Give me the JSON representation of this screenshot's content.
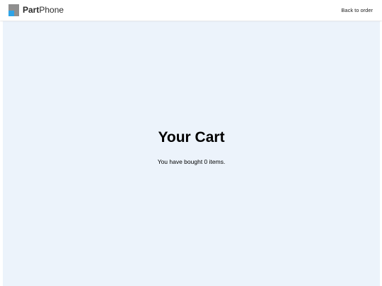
{
  "header": {
    "logo": {
      "text_strong": "Part",
      "text_regular": "Phone",
      "icon": "partphone-logo-icon",
      "colors": {
        "back_square": "#8f8f8f",
        "front_square": "#2fa4e7"
      }
    },
    "back_link_label": "Back to order"
  },
  "main": {
    "title": "Your Cart",
    "summary": "You have bought 0 items.",
    "background_color": "#ecf3fb"
  }
}
